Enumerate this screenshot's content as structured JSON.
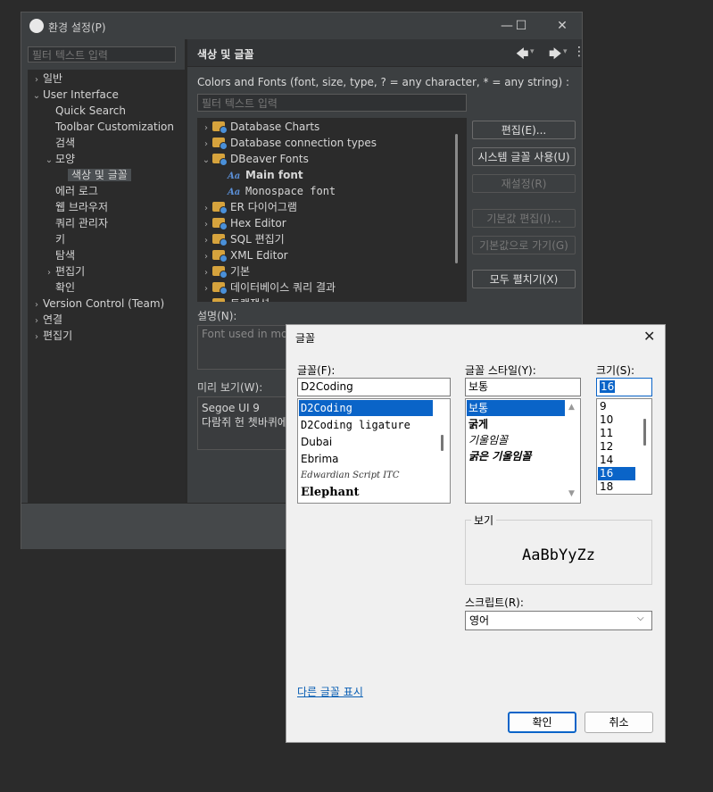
{
  "preferences": {
    "title": "환경 설정(P)",
    "window_controls": {
      "minimize": "—",
      "maximize": "☐",
      "close": "✕"
    },
    "left_filter_placeholder": "필터 텍스트 입력",
    "tree": [
      {
        "label": "일반",
        "chevron": "›",
        "level": 0
      },
      {
        "label": "User Interface",
        "chevron": "⌄",
        "level": 0
      },
      {
        "label": "Quick Search",
        "chevron": "",
        "level": 1
      },
      {
        "label": "Toolbar Customization",
        "chevron": "",
        "level": 1
      },
      {
        "label": "검색",
        "chevron": "",
        "level": 1
      },
      {
        "label": "모양",
        "chevron": "⌄",
        "level": 1
      },
      {
        "label": "색상 및 글꼴",
        "chevron": "",
        "level": 2,
        "selected": true
      },
      {
        "label": "에러 로그",
        "chevron": "",
        "level": 1
      },
      {
        "label": "웹 브라우저",
        "chevron": "",
        "level": 1
      },
      {
        "label": "쿼리 관리자",
        "chevron": "",
        "level": 1
      },
      {
        "label": "키",
        "chevron": "",
        "level": 1
      },
      {
        "label": "탐색",
        "chevron": "",
        "level": 1
      },
      {
        "label": "편집기",
        "chevron": "›",
        "level": 1
      },
      {
        "label": "확인",
        "chevron": "",
        "level": 1
      },
      {
        "label": "Version Control (Team)",
        "chevron": "›",
        "level": 0
      },
      {
        "label": "연결",
        "chevron": "›",
        "level": 0
      },
      {
        "label": "편집기",
        "chevron": "›",
        "level": 0
      }
    ],
    "page": {
      "title": "색상 및 글꼴",
      "nav": {
        "back": "🡄",
        "forward": "🡆",
        "dropdown": "▾",
        "menu": "⋮"
      },
      "description": "Colors and Fonts (font, size, type, ? = any character, * = any string) :",
      "filter_placeholder": "필터 텍스트 입력",
      "fonts_tree": [
        {
          "label": "Database Charts",
          "kind": "folder",
          "chevron": "›"
        },
        {
          "label": "Database connection types",
          "kind": "folder",
          "chevron": "›"
        },
        {
          "label": "DBeaver Fonts",
          "kind": "folder",
          "chevron": "⌄"
        },
        {
          "label": "Main font",
          "kind": "font",
          "bold": true
        },
        {
          "label": "Monospace font",
          "kind": "font",
          "mono": true
        },
        {
          "label": "ER 다이어그램",
          "kind": "folder",
          "chevron": "›"
        },
        {
          "label": "Hex Editor",
          "kind": "folder",
          "chevron": "›"
        },
        {
          "label": "SQL 편집기",
          "kind": "folder",
          "chevron": "›"
        },
        {
          "label": "XML Editor",
          "kind": "folder",
          "chevron": "›"
        },
        {
          "label": "기본",
          "kind": "folder",
          "chevron": "›"
        },
        {
          "label": "데이터베이스 쿼리 결과",
          "kind": "folder",
          "chevron": "›"
        },
        {
          "label": "트랜잭션",
          "kind": "folder",
          "chevron": "›"
        }
      ],
      "font_icon_text": "Aa",
      "buttons": {
        "edit": "편집(E)...",
        "use_system": "시스템 글꼴 사용(U)",
        "reset": "재설정(R)",
        "edit_default": "기본값 편집(I)...",
        "go_default": "기본값으로 가기(G)",
        "expand_all": "모두 펼치기(X)"
      },
      "description_label": "설명(N):",
      "description_text": "Font used in most",
      "preview_label": "미리 보기(W):",
      "preview_font": "Segoe UI 9",
      "preview_sample": "다람쥐 헌 쳇바퀴에"
    }
  },
  "font_dialog": {
    "title": "글꼴",
    "close": "✕",
    "font_label": "글꼴(F):",
    "font_value": "D2Coding",
    "fonts": [
      "D2Coding",
      "D2Coding ligature",
      "Dubai",
      "Ebrima",
      "Edwardian Script ITC",
      "Elephant"
    ],
    "selected_font": "D2Coding",
    "style_label": "글꼴 스타일(Y):",
    "style_value": "보통",
    "styles": [
      "보통",
      "굵게",
      "기울임꼴",
      "굵은 기울임꼴"
    ],
    "selected_style": "보통",
    "size_label": "크기(S):",
    "size_value": "16",
    "sizes": [
      "9",
      "10",
      "11",
      "12",
      "14",
      "16",
      "18"
    ],
    "selected_size": "16",
    "sample_label": "보기",
    "sample_text": "AaBbYyZz",
    "script_label": "스크립트(R):",
    "script_value": "영어",
    "more_fonts_link": "다른 글꼴 표시",
    "ok": "확인",
    "cancel": "취소",
    "accent": "#0a64c8"
  }
}
